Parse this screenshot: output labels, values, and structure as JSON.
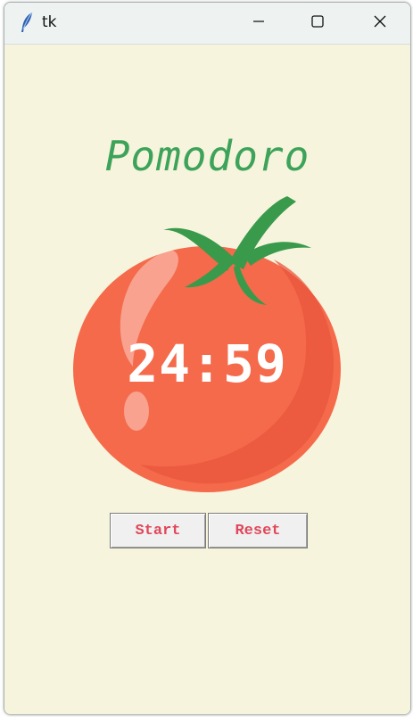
{
  "window": {
    "title": "tk"
  },
  "colors": {
    "background": "#f7f4dd",
    "title_green": "#3ea35a",
    "tomato_red": "#f46a4b",
    "leaf_green": "#3a9a4b",
    "button_text": "#e0485a"
  },
  "app": {
    "title": "Pomodoro",
    "timer": "24:59",
    "start_label": "Start",
    "reset_label": "Reset"
  },
  "icons": {
    "app": "feather-icon",
    "minimize": "minimize-icon",
    "maximize": "maximize-icon",
    "close": "close-icon",
    "tomato": "tomato-image"
  }
}
